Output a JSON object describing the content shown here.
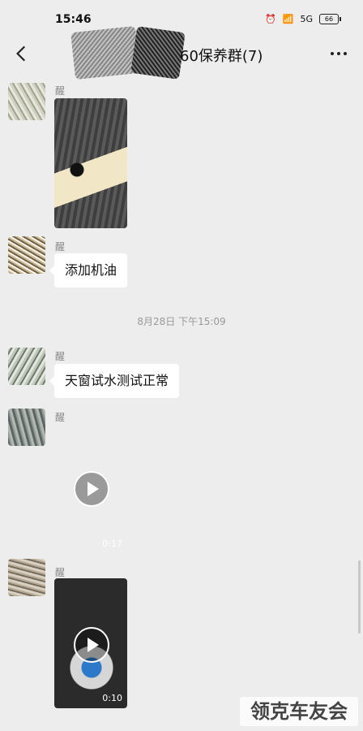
{
  "status": {
    "time": "15:46",
    "network": "5G",
    "battery": "66"
  },
  "header": {
    "title": "60保养群(7)"
  },
  "messages": [
    {
      "sender": "醒",
      "type": "image"
    },
    {
      "sender": "醒",
      "type": "text",
      "text": "添加机油"
    },
    {
      "sender": "醒",
      "type": "text",
      "text": "天窗试水测试正常"
    },
    {
      "sender": "醒",
      "type": "video",
      "duration": "0:17"
    },
    {
      "sender": "醒",
      "type": "video",
      "duration": "0:10"
    }
  ],
  "timestamp": "8月28日 下午15:09",
  "watermark": "领克车友会"
}
